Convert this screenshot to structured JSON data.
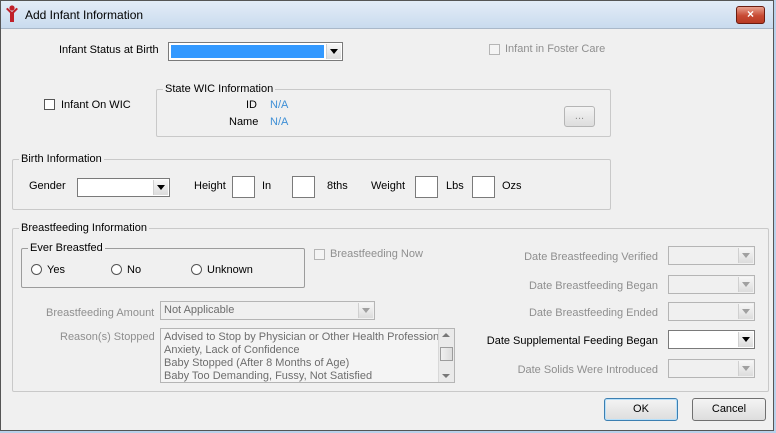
{
  "window": {
    "title": "Add Infant Information",
    "close_label": "×"
  },
  "infant_status": {
    "label": "Infant Status at Birth"
  },
  "foster_care": {
    "label": "Infant in Foster Care",
    "checked": false
  },
  "wic": {
    "checkbox_label": "Infant On WIC",
    "group_label": "State WIC Information",
    "id_label": "ID",
    "id_value": "N/A",
    "name_label": "Name",
    "name_value": "N/A",
    "browse_label": "..."
  },
  "birth": {
    "group_label": "Birth Information",
    "gender_label": "Gender",
    "height_label": "Height",
    "in_label": "In",
    "eighths_label": "8ths",
    "weight_label": "Weight",
    "lbs_label": "Lbs",
    "ozs_label": "Ozs"
  },
  "breastfeeding": {
    "group_label": "Breastfeeding Information",
    "ever_group_label": "Ever Breastfed",
    "options": [
      "Yes",
      "No",
      "Unknown"
    ],
    "now_label": "Breastfeeding Now",
    "amount_label": "Breastfeeding Amount",
    "amount_value": "Not Applicable",
    "reasons_label": "Reason(s) Stopped",
    "reasons": [
      "Advised to Stop by Physician or Other Health Professional",
      "Anxiety, Lack of Confidence",
      "Baby Stopped (After 8 Months of Age)",
      "Baby Too Demanding, Fussy, Not Satisfied"
    ],
    "dates": {
      "verified": "Date Breastfeeding Verified",
      "began": "Date Breastfeeding Began",
      "ended": "Date Breastfeeding Ended",
      "supplemental": "Date Supplemental Feeding Began",
      "solids": "Date Solids Were Introduced"
    }
  },
  "buttons": {
    "ok": "OK",
    "cancel": "Cancel"
  },
  "colors": {
    "selection": "#3399ff",
    "link": "#3e8fd6"
  }
}
